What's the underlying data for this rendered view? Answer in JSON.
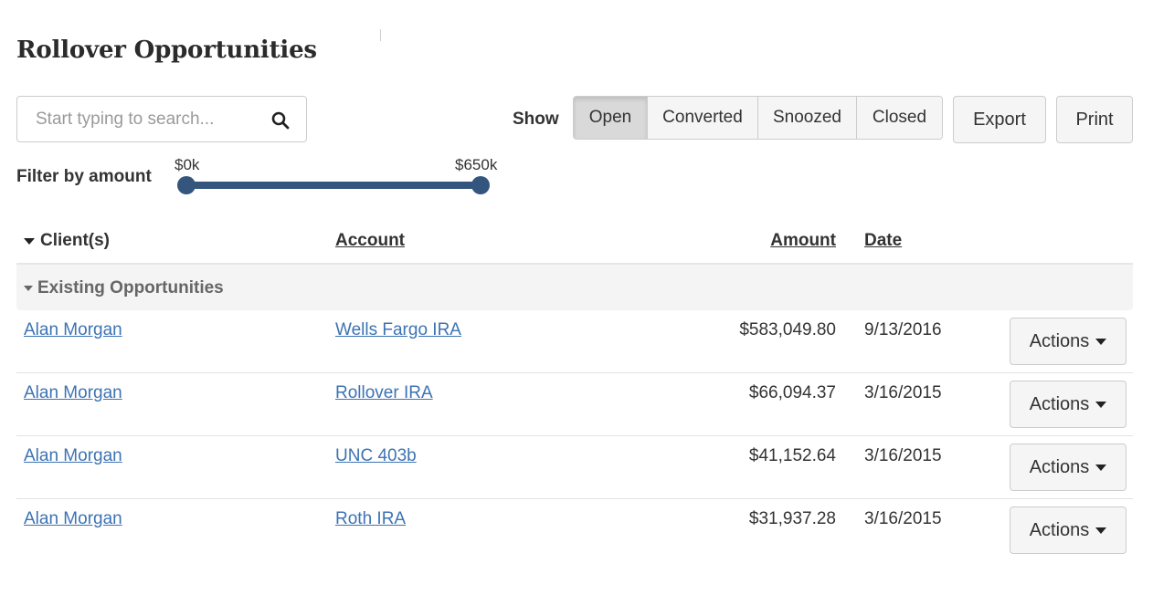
{
  "page": {
    "title": "Rollover Opportunities"
  },
  "search": {
    "placeholder": "Start typing to search...",
    "value": "",
    "icon": "search-icon"
  },
  "show_filter": {
    "label": "Show",
    "options": [
      {
        "label": "Open",
        "active": true
      },
      {
        "label": "Converted",
        "active": false
      },
      {
        "label": "Snoozed",
        "active": false
      },
      {
        "label": "Closed",
        "active": false
      }
    ]
  },
  "toolbar": {
    "export_label": "Export",
    "print_label": "Print"
  },
  "amount_filter": {
    "label": "Filter by amount",
    "min_label": "$0k",
    "max_label": "$650k",
    "range_min": 0,
    "range_max": 650,
    "selected_min": 0,
    "selected_max": 650,
    "accent_color": "#34557d"
  },
  "table": {
    "columns": {
      "client": "Client(s)",
      "account": "Account",
      "amount": "Amount",
      "date": "Date"
    },
    "group_label": "Existing Opportunities",
    "actions_label": "Actions",
    "link_color": "#3d73b3",
    "rows": [
      {
        "client": "Alan Morgan",
        "account": "Wells Fargo IRA",
        "amount": "$583,049.80",
        "date": "9/13/2016"
      },
      {
        "client": "Alan Morgan",
        "account": "Rollover IRA",
        "amount": "$66,094.37",
        "date": "3/16/2015"
      },
      {
        "client": "Alan Morgan",
        "account": "UNC 403b",
        "amount": "$41,152.64",
        "date": "3/16/2015"
      },
      {
        "client": "Alan Morgan",
        "account": "Roth IRA",
        "amount": "$31,937.28",
        "date": "3/16/2015"
      }
    ]
  }
}
